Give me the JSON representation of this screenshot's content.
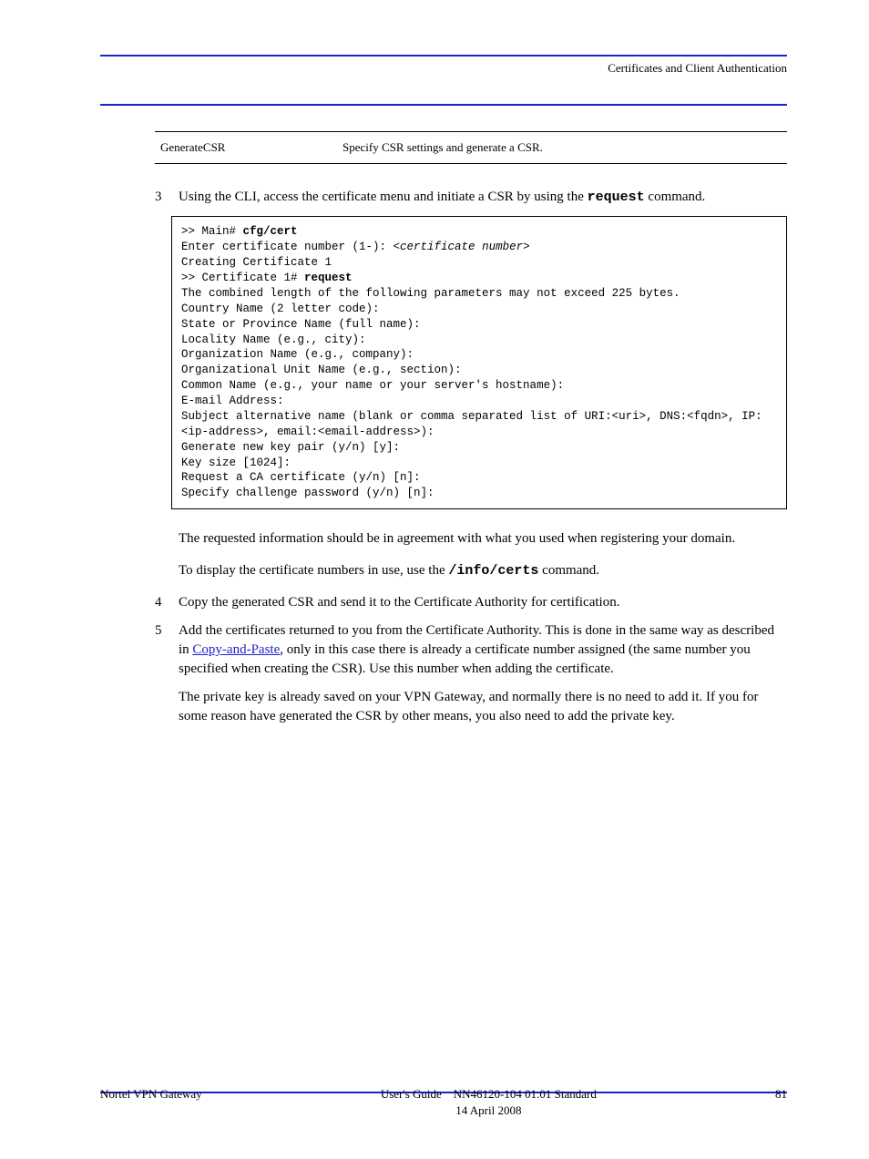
{
  "header": {
    "right": "Certificates and Client Authentication"
  },
  "table": {
    "left": "GenerateCSR",
    "right": "Specify CSR settings and generate a CSR."
  },
  "step3": {
    "num": "3",
    "text_prefix": "Using the CLI, access the certificate menu and initiate a CSR by using the ",
    "mono": "request",
    "text_suffix": " command."
  },
  "code_lines": [
    {
      "prefix": ">> Main# ",
      "bold": "cfg/cert"
    },
    {
      "text": "Enter certificate number (1-): ",
      "italic": "<certificate number>"
    },
    {
      "text": "Creating Certificate 1"
    },
    {
      "prefix": ">> Certificate 1# ",
      "bold": "request"
    },
    {
      "text": "The combined length of the following parameters may not exceed 225 bytes."
    },
    {
      "text": "Country Name (2 letter code):"
    },
    {
      "text": "State or Province Name (full name):"
    },
    {
      "text": "Locality Name (e.g., city):"
    },
    {
      "text": "Organization Name (e.g., company):"
    },
    {
      "text": "Organizational Unit Name (e.g., section):"
    },
    {
      "text": "Common Name (e.g., your name or your server's hostname):"
    },
    {
      "text": "E-mail Address:"
    },
    {
      "text": "Subject alternative name (blank or comma separated list of URI:<uri>, DNS:<fqdn>, IP:<ip-address>, email:<email-address>):"
    },
    {
      "text": "Generate new key pair (y/n) [y]:"
    },
    {
      "text": "Key size [1024]:"
    },
    {
      "text": "Request a CA certificate (y/n) [n]:"
    },
    {
      "text": "Specify challenge password (y/n) [n]:"
    }
  ],
  "para_after_code": "The requested information should be in agreement with what you used when registering your domain.",
  "para_display_prefix": "To display the certificate numbers in use, use the ",
  "para_display_mono": "/info/certs",
  "para_display_suffix": " command.",
  "step4": {
    "num": "4",
    "text": "Copy the generated CSR and send it to the Certificate Authority for certification."
  },
  "step5": {
    "num": "5",
    "text_prefix": "Add the certificates returned to you from the Certificate Authority. This is done in the same way as described in ",
    "link": "Copy-and-Paste",
    "text_suffix": ", only in this case there is already a certificate number assigned (the same number you specified when creating the CSR). Use this number when adding the certificate."
  },
  "para_after_step5": "The private key is already saved on your VPN Gateway, and normally there is no need to add it. If you for some reason have generated the CSR by other means, you also need to add the private key.",
  "footer": {
    "left": "Nortel VPN Gateway",
    "center": "User's Guide",
    "right": "NN46120-104 01.01 Standard",
    "line2": "14 April 2008",
    "page": "81"
  }
}
